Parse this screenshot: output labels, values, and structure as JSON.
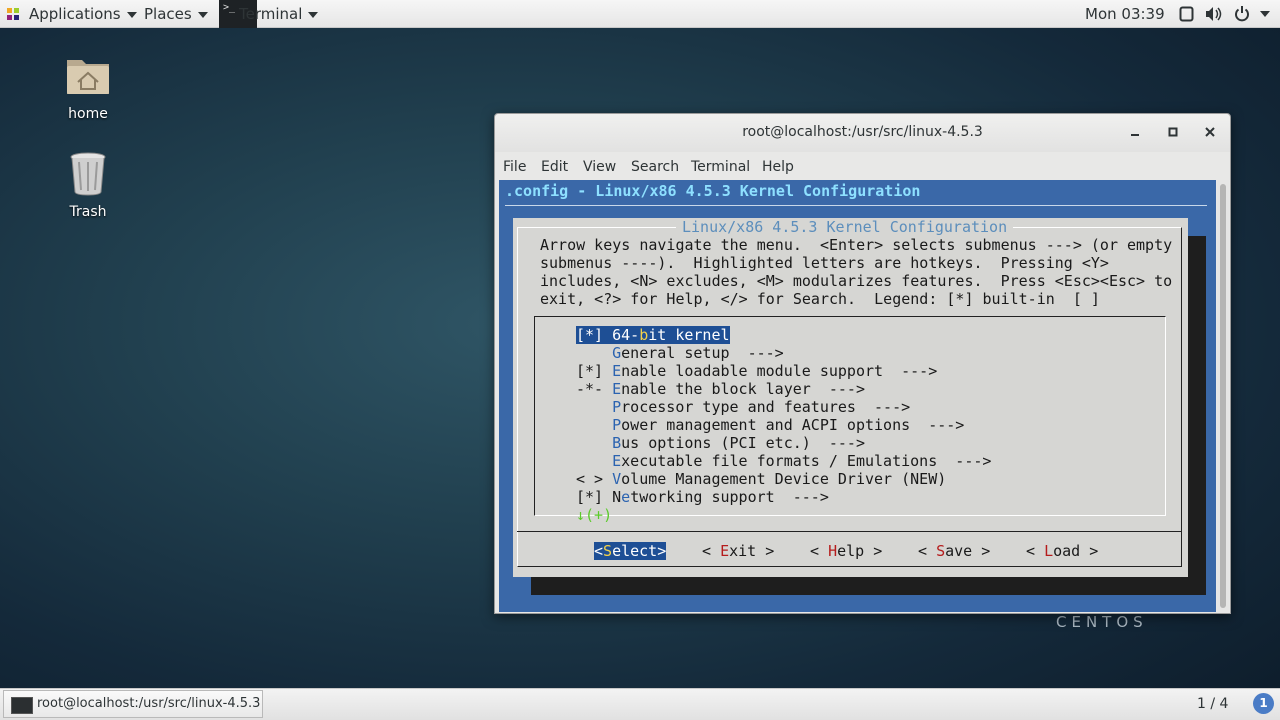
{
  "top_panel": {
    "applications_label": "Applications",
    "places_label": "Places",
    "terminal_label": "Terminal",
    "clock": "Mon 03:39"
  },
  "desktop": {
    "icons": [
      {
        "label": "home"
      },
      {
        "label": "Trash"
      }
    ],
    "watermark": "CENTOS"
  },
  "window": {
    "title": "root@localhost:/usr/src/linux-4.5.3",
    "menus": [
      "File",
      "Edit",
      "View",
      "Search",
      "Terminal",
      "Help"
    ]
  },
  "terminal": {
    "header": ".config - Linux/x86 4.5.3 Kernel Configuration",
    "dialog_title": "Linux/x86 4.5.3 Kernel Configuration",
    "help_lines": [
      "Arrow keys navigate the menu.  <Enter> selects submenus ---> (or empty",
      "submenus ----).  Highlighted letters are hotkeys.  Pressing <Y>",
      "includes, <N> excludes, <M> modularizes features.  Press <Esc><Esc> to",
      "exit, <?> for Help, </> for Search.  Legend: [*] built-in  [ ]"
    ],
    "menu_items": [
      {
        "prefix": "[*] ",
        "pre": "64-",
        "hk": "b",
        "post": "it kernel",
        "selected": true
      },
      {
        "prefix": "    ",
        "pre": "",
        "hk": "G",
        "post": "eneral setup  --->"
      },
      {
        "prefix": "[*] ",
        "pre": "",
        "hk": "E",
        "post": "nable loadable module support  --->"
      },
      {
        "prefix": "-*- ",
        "pre": "",
        "hk": "E",
        "post": "nable the block layer  --->"
      },
      {
        "prefix": "    ",
        "pre": "",
        "hk": "P",
        "post": "rocessor type and features  --->"
      },
      {
        "prefix": "    ",
        "pre": "",
        "hk": "P",
        "post": "ower management and ACPI options  --->"
      },
      {
        "prefix": "    ",
        "pre": "",
        "hk": "B",
        "post": "us options (PCI etc.)  --->"
      },
      {
        "prefix": "    ",
        "pre": "",
        "hk": "E",
        "post": "xecutable file formats / Emulations  --->"
      },
      {
        "prefix": "< > ",
        "pre": "",
        "hk": "V",
        "post": "olume Management Device Driver (NEW)"
      },
      {
        "prefix": "[*] ",
        "pre": "N",
        "hk": "e",
        "post": "tworking support  --->"
      }
    ],
    "more_indicator": "↓(+)",
    "buttons": [
      {
        "pre": "<",
        "hk": "S",
        "post": "elect>",
        "active": true
      },
      {
        "pre": "< ",
        "hk": "E",
        "post": "xit >"
      },
      {
        "pre": "< ",
        "hk": "H",
        "post": "elp >"
      },
      {
        "pre": "< ",
        "hk": "S",
        "post": "ave >"
      },
      {
        "pre": "< ",
        "hk": "L",
        "post": "oad >"
      }
    ]
  },
  "bottom_panel": {
    "task_label": "root@localhost:/usr/src/linux-4.5.3",
    "workspace": "1 / 4",
    "notifications": "1"
  }
}
